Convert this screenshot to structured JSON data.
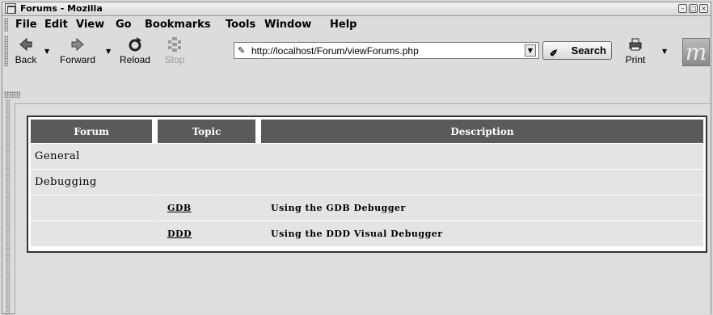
{
  "window": {
    "title": "Forums - Mozilla",
    "controls": [
      "minimize",
      "maximize",
      "close"
    ]
  },
  "menu": {
    "items": [
      "File",
      "Edit",
      "View",
      "Go",
      "Bookmarks",
      "Tools",
      "Window",
      "Help"
    ]
  },
  "toolbar": {
    "back_label": "Back",
    "forward_label": "Forward",
    "reload_label": "Reload",
    "stop_label": "Stop",
    "print_label": "Print",
    "search_label": "Search",
    "url": "http://localhost/Forum/viewForums.php",
    "logo_text": "m"
  },
  "table": {
    "headers": [
      "Forum",
      "Topic",
      "Description"
    ],
    "forums": [
      {
        "name": "General",
        "topics": []
      },
      {
        "name": "Debugging",
        "topics": [
          {
            "topic": "GDB",
            "description": "Using the GDB Debugger"
          },
          {
            "topic": "DDD",
            "description": "Using the DDD Visual Debugger"
          }
        ]
      }
    ]
  }
}
